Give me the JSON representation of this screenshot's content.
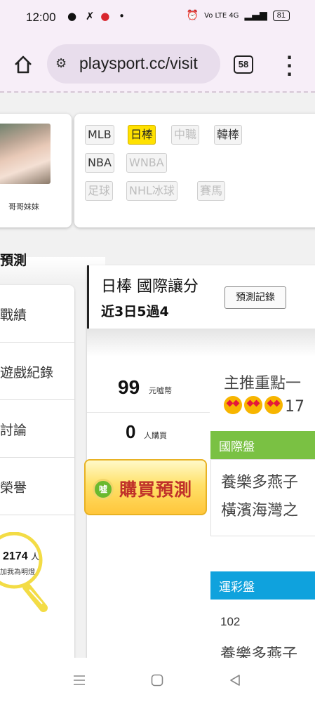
{
  "status_bar": {
    "time": "12:00",
    "left_icons": "● ✗ ● •",
    "network": "Vo LTE 4G",
    "battery": "81"
  },
  "browser": {
    "url": "playsport.cc/visit",
    "tab_count": "58"
  },
  "profile": {
    "name": "哥哥妹妹"
  },
  "tags": {
    "mlb": "MLB",
    "npb": "日棒",
    "cpbl": "中職",
    "kbo": "韓棒",
    "nba": "NBA",
    "wnba": "WNBA",
    "soccer": "足球",
    "nhl": "NHL冰球",
    "horse": "賽馬"
  },
  "section": {
    "title": "預測"
  },
  "side_menu": {
    "items": [
      "戰績",
      "遊戲紀錄",
      "討論",
      "榮譽"
    ]
  },
  "lightbulb": {
    "count": "2174",
    "unit": "人",
    "caption": "加我為明燈"
  },
  "main": {
    "league": "日棒 國際讓分",
    "record": "近3日5過4",
    "record_button": "預測記錄",
    "price": "99",
    "price_unit": "元噓幣",
    "buyers": "0",
    "buyers_unit": "人購買",
    "buy_button": "購買預測",
    "buy_icon_text": "噓",
    "pick_title": "主推重點一",
    "pick_count": "17",
    "intl_label": "國際盤",
    "intl_team1": "養樂多燕子",
    "intl_team2": "橫濱海灣之",
    "lottery_label": "運彩盤",
    "lottery_number": "102",
    "lottery_team": "養樂多燕子"
  },
  "colors": {
    "active_tag": "#ffe100",
    "intl_bar": "#7ac143",
    "lottery_bar": "#0fa2dd",
    "buy_text": "#c0312a"
  },
  "nav": {
    "recent_icon": "recent-apps-icon",
    "home_icon": "home-icon",
    "back_icon": "back-icon"
  }
}
